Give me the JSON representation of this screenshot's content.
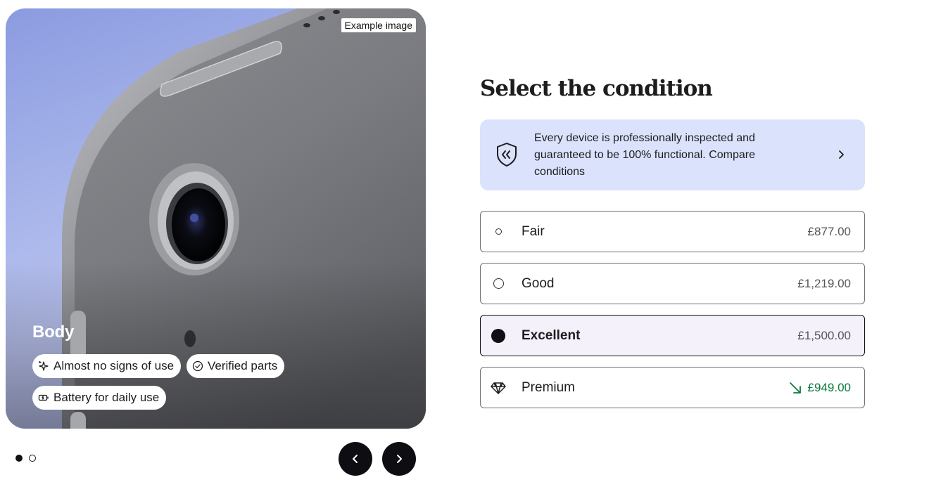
{
  "media": {
    "example_label": "Example image",
    "title": "Body",
    "chips": [
      {
        "label": "Almost no signs of use",
        "icon": "sparkle-icon"
      },
      {
        "label": "Verified parts",
        "icon": "check-circle-icon"
      },
      {
        "label": "Battery for daily use",
        "icon": "battery-icon"
      }
    ],
    "carousel": {
      "slide_count": 2,
      "active_index": 0,
      "prev_icon": "chevron-left-icon",
      "next_icon": "chevron-right-icon"
    }
  },
  "condition": {
    "heading": "Select the condition",
    "info": {
      "text": "Every device is professionally inspected and guaranteed to be 100% functional. Compare conditions",
      "icon": "shield-icon",
      "arrow_icon": "chevron-right-icon"
    },
    "options": [
      {
        "label": "Fair",
        "price": "£877.00",
        "selected": false
      },
      {
        "label": "Good",
        "price": "£1,219.00",
        "selected": false
      },
      {
        "label": "Excellent",
        "price": "£1,500.00",
        "selected": true
      },
      {
        "label": "Premium",
        "price": "£949.00",
        "selected": false,
        "icon": "diamond-icon",
        "price_icon": "arrow-down-right-icon"
      }
    ]
  },
  "colors": {
    "banner_bg": "#dbe2fb",
    "selected_bg": "#f4f1fb",
    "deal_green": "#0b7a3e",
    "button_dark": "#0d0d12"
  }
}
